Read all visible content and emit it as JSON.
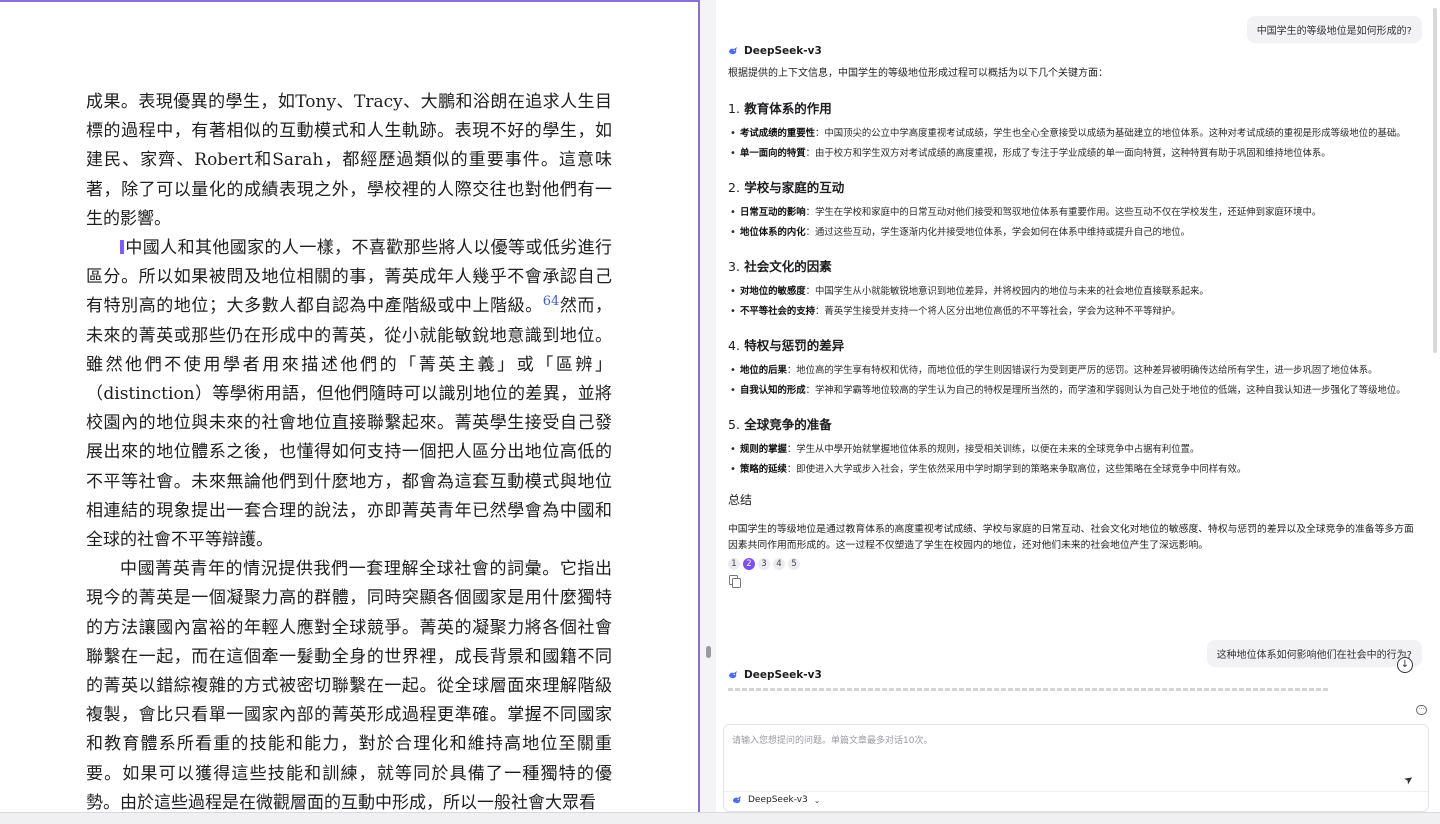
{
  "document": {
    "paragraphs": [
      {
        "indent": false,
        "text": "成果。表現優異的學生，如Tony、Tracy、大鵬和浴朗在追求人生目標的過程中，有著相似的互動模式和人生軌跡。表現不好的學生，如建民、家齊、Robert和Sarah，都經歷過類似的重要事件。這意味著，除了可以量化的成績表現之外，學校裡的人際交往也對他們有一生的影響。"
      },
      {
        "indent": true,
        "marker": true,
        "text_before": "中國人和其他國家的人一樣，不喜歡那些將人以優等或低劣進行區分。所以如果被問及地位相關的事，菁英成年人幾乎不會承認自己有特別高的地位；大多數人都自認為中產階級或中上階級。",
        "footnote": "64",
        "text_after": "然而，未來的菁英或那些仍在形成中的菁英，從小就能敏銳地意識到地位。雖然他們不使用學者用來描述他們的「菁英主義」或「區辨」（distinction）等學術用語，但他們隨時可以識別地位的差異，並將校園內的地位與未來的社會地位直接聯繫起來。菁英學生接受自己發展出來的地位體系之後，也懂得如何支持一個把人區分出地位高低的不平等社會。未來無論他們到什麼地方，都會為這套互動模式與地位相連結的現象提出一套合理的說法，亦即菁英青年已然學會為中國和全球的社會不平等辯護。"
      },
      {
        "indent": true,
        "text": "中國菁英青年的情況提供我們一套理解全球社會的詞彙。它指出現今的菁英是一個凝聚力高的群體，同時突顯各個國家是用什麼獨特的方法讓國內富裕的年輕人應對全球競爭。菁英的凝聚力將各個社會聯繫在一起，而在這個牽一髮動全身的世界裡，成長背景和國籍不同的菁英以錯綜複雜的方式被密切聯繫在一起。從全球層面來理解階級複製，會比只看單一國家內部的菁英形成過程更準確。掌握不同國家和教育體系所看重的技能和能力，對於合理化和維持高地位至關重要。如果可以獲得這些技能和訓練，就等同於具備了一種獨特的優勢。由於這些過程是在微觀層面的互動中形成，所以一般社會大眾看"
      }
    ]
  },
  "chat": {
    "messages": {
      "user_question_1": "中国学生的等级地位是如何形成的?",
      "bot_name": "DeepSeek-v3",
      "answer_intro": "根据提供的上下文信息，中国学生的等级地位形成过程可以概括为以下几个关键方面：",
      "sections": [
        {
          "num": "1.",
          "title": "教育体系的作用",
          "items": [
            {
              "term": "考试成绩的重要性",
              "desc": "：中国顶尖的公立中学高度重视考试成绩，学生也全心全意接受以成绩为基础建立的地位体系。这种对考试成绩的重视是形成等级地位的基础。"
            },
            {
              "term": "单一面向的特質",
              "desc": "：由于校方和学生双方对考试成绩的高度重视，形成了专注于学业成绩的单一面向特質，这种特質有助于巩固和维持地位体系。"
            }
          ]
        },
        {
          "num": "2.",
          "title": "学校与家庭的互动",
          "items": [
            {
              "term": "日常互动的影响",
              "desc": "：学生在学校和家庭中的日常互动对他们接受和驾驭地位体系有重要作用。这些互动不仅在学校发生，还延伸到家庭环境中。"
            },
            {
              "term": "地位体系的内化",
              "desc": "：通过这些互动，学生逐渐内化并接受地位体系，学会如何在体系中维持或提升自己的地位。"
            }
          ]
        },
        {
          "num": "3.",
          "title": "社会文化的因素",
          "items": [
            {
              "term": "对地位的敏感度",
              "desc": "：中国学生从小就能敏锐地意识到地位差异，并将校园内的地位与未来的社会地位直接联系起来。"
            },
            {
              "term": "不平等社会的支持",
              "desc": "：菁英学生接受并支持一个将人区分出地位高低的不平等社会，学会为这种不平等辩护。"
            }
          ]
        },
        {
          "num": "4.",
          "title": "特权与惩罚的差异",
          "items": [
            {
              "term": "地位的后果",
              "desc": "：地位高的学生享有特权和优待，而地位低的学生则因错误行为受到更严厉的惩罚。这种差异被明确传达给所有学生，进一步巩固了地位体系。"
            },
            {
              "term": "自我认知的形成",
              "desc": "：学神和学霸等地位较高的学生认为自己的特权是理所当然的，而学渣和学弱则认为自己处于地位的低端，这种自我认知进一步强化了等级地位。"
            }
          ]
        },
        {
          "num": "5.",
          "title": "全球竞争的准备",
          "items": [
            {
              "term": "规则的掌握",
              "desc": "：学生从中學开始就掌握地位体系的规则，接受相关训练，以便在未来的全球竞争中占据有利位置。"
            },
            {
              "term": "策略的延续",
              "desc": "：即使进入大学或步入社会，学生依然采用中学时期学到的策略来争取高位，这些策略在全球竞争中同样有效。"
            }
          ]
        }
      ],
      "summary_title": "总结",
      "summary_text": "中国学生的等级地位是通过教育体系的高度重视考试成绩、学校与家庭的日常互动、社会文化对地位的敏感度、特权与惩罚的差异以及全球竞争的准备等多方面因素共同作用而形成的。这一过程不仅塑造了学生在校园内的地位，还对他们未来的社会地位产生了深远影响。",
      "citations": [
        "1",
        "2",
        "3",
        "4",
        "5"
      ],
      "active_citation": "2",
      "user_question_2": "这种地位体系如何影响他们在社会中的行为?",
      "bot_name_2": "DeepSeek-v3"
    },
    "input": {
      "placeholder": "请输入您想提问的问题。单篇文章最多对话10次。",
      "value": "",
      "model_label": "DeepSeek-v3"
    },
    "icons": {
      "bot_logo": "deepseek-whale-icon",
      "scroll_down": "arrow-down-circle-icon",
      "send": "send-plane-icon",
      "copy": "copy-icon",
      "new_chat": "chat-bubble-icon",
      "model_chevron": "chevron-down-icon"
    },
    "colors": {
      "accent": "#7c4dff",
      "pane_border": "#8b6fd9",
      "bot_logo": "#4d6bfe"
    }
  }
}
